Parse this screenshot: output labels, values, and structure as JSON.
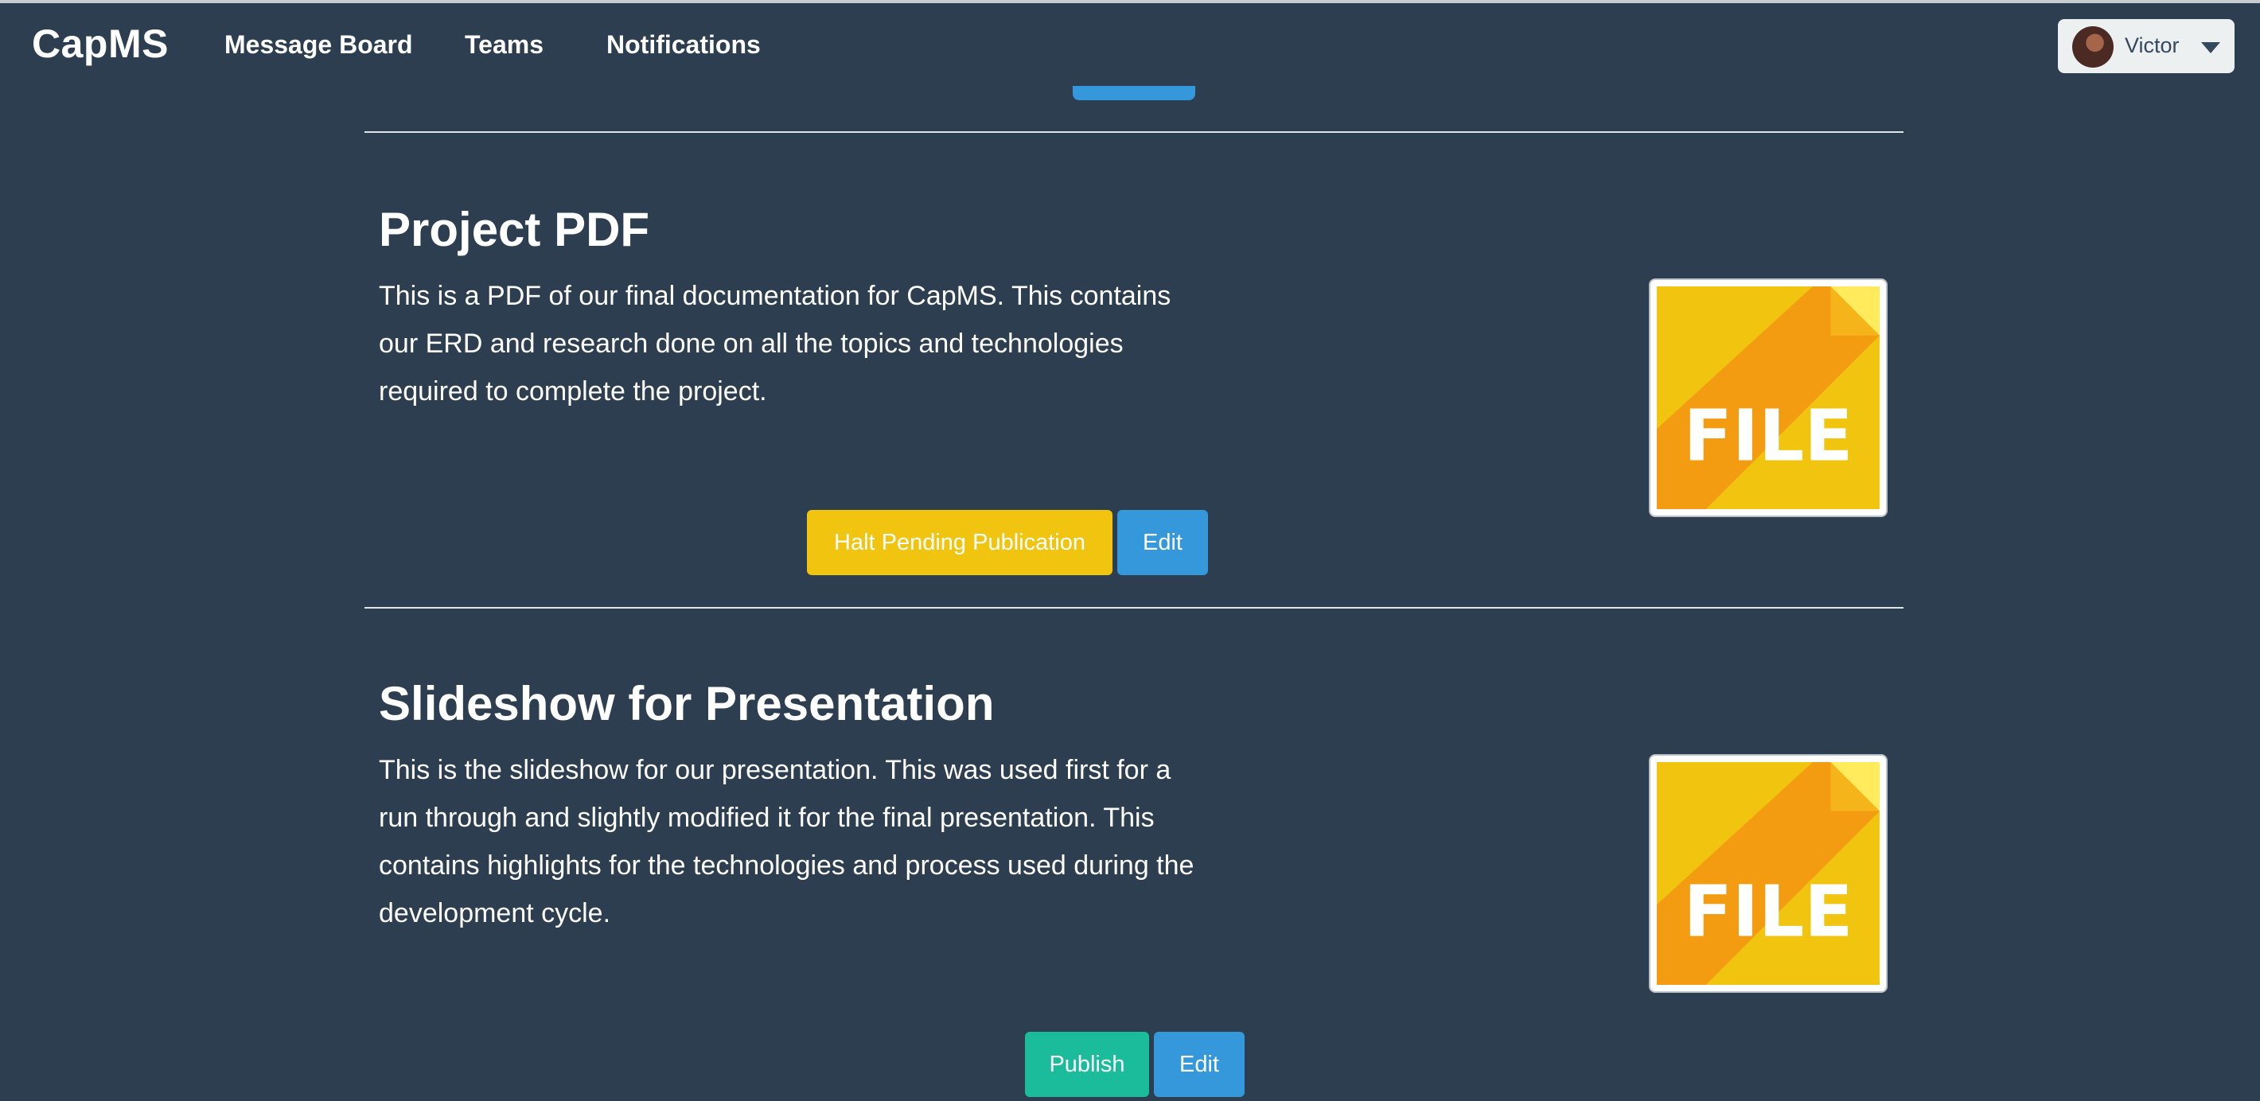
{
  "navbar": {
    "brand": "CapMS",
    "links": [
      "Message Board",
      "Teams",
      "Notifications"
    ],
    "user": {
      "name": "Victor"
    }
  },
  "documents": [
    {
      "title": "Project PDF",
      "description": "This is a PDF of our final documentation for CapMS. This contains our ERD and research done on all the topics and technologies required to complete the project.",
      "thumbnail_label": "FILE",
      "buttons": [
        "Halt Pending Publication",
        "Edit"
      ]
    },
    {
      "title": "Slideshow for Presentation",
      "description": "This is the slideshow for our presentation. This was used first for a run through and slightly modified it for the final presentation. This contains highlights for the technologies and process used during the development cycle.",
      "thumbnail_label": "FILE",
      "buttons": [
        "Publish",
        "Edit"
      ]
    }
  ],
  "colors": {
    "background": "#2c3e50",
    "warning": "#f1c40f",
    "info": "#3498db",
    "success": "#1abc9c",
    "file_icon_yellow": "#f1c40f",
    "file_icon_orange": "#f39c12",
    "file_icon_fold": "#ffeb5b"
  },
  "icons": {
    "file": "file-icon",
    "caret": "caret-down-icon"
  }
}
